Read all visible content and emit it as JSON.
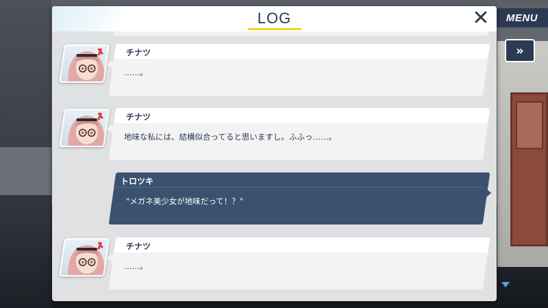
{
  "hud": {
    "menu_label": "MENU",
    "fast_forward_icon": "double-chevron-right-icon"
  },
  "log": {
    "title": "LOG",
    "close_icon": "close-icon",
    "entries": [
      {
        "speaker": "チナツ",
        "text": "……。",
        "is_player": false
      },
      {
        "speaker": "チナツ",
        "text": "地味な私には、結構似合ってると思いますし。ふふっ……。",
        "is_player": false
      },
      {
        "speaker": "トロツキ",
        "text": "\"メガネ美少女が地味だって！？\"",
        "is_player": true
      },
      {
        "speaker": "チナツ",
        "text": "……。",
        "is_player": false
      }
    ]
  },
  "colors": {
    "header_text": "#2a3a52",
    "accent_yellow": "#f5d21e",
    "player_bubble": "#3b5170",
    "npc_bubble": "#f3f3f4",
    "menu_button": "#2b3a52"
  }
}
